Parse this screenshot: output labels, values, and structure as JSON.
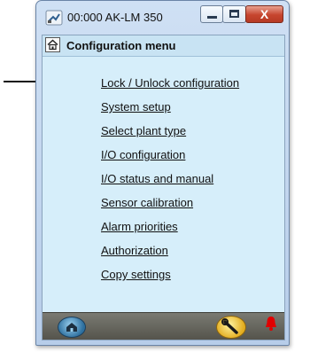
{
  "window": {
    "title": "00:000 AK-LM 350",
    "close_glyph": "X"
  },
  "menu": {
    "title": "Configuration menu",
    "items": [
      "Lock / Unlock configuration",
      "System setup",
      "Select plant type",
      "I/O configuration",
      "I/O status and manual",
      "Sensor calibration",
      "Alarm priorities",
      "Authorization",
      "Copy settings"
    ]
  },
  "icons": {
    "app": "network-plug-icon",
    "home": "home-icon",
    "footer_home": "home-circle-icon",
    "tool": "wrench-icon",
    "alarm": "alarm-bell-icon"
  },
  "colors": {
    "client_bg": "#d6eefa",
    "close_button": "#c6452e",
    "footer_bar": "#66655d",
    "alarm": "#e00000"
  }
}
